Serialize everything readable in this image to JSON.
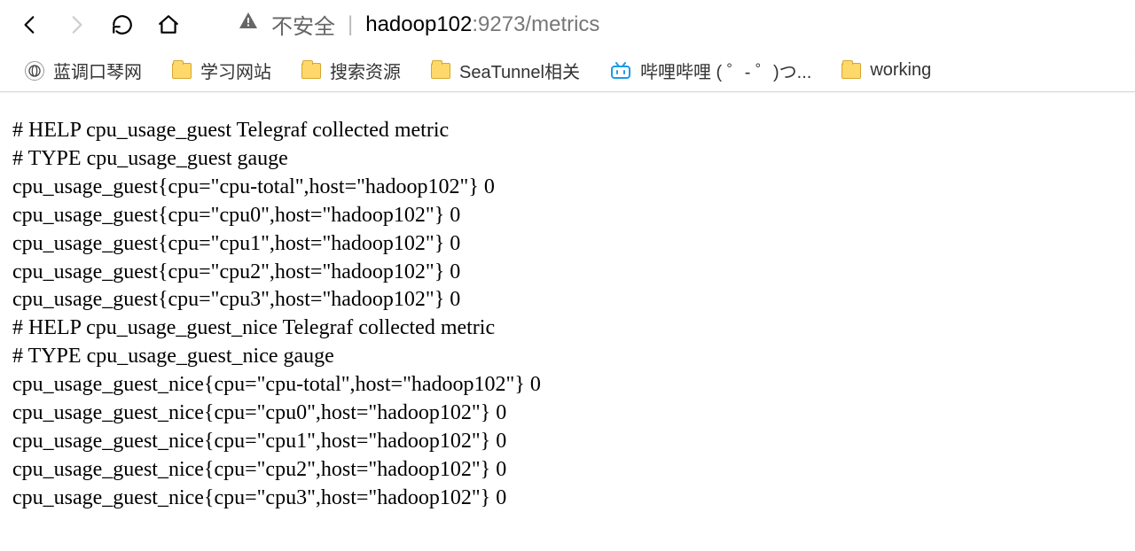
{
  "address": {
    "security_label": "不安全",
    "host": "hadoop102",
    "port_path": ":9273/metrics"
  },
  "bookmarks": [
    {
      "icon": "site",
      "label": "蓝调口琴网"
    },
    {
      "icon": "folder",
      "label": "学习网站"
    },
    {
      "icon": "folder",
      "label": "搜索资源"
    },
    {
      "icon": "folder",
      "label": "SeaTunnel相关"
    },
    {
      "icon": "bili",
      "label": "哔哩哔哩 ( ゜- ゜)つ..."
    },
    {
      "icon": "folder",
      "label": "working"
    }
  ],
  "metrics": {
    "lines": [
      "# HELP cpu_usage_guest Telegraf collected metric",
      "# TYPE cpu_usage_guest gauge",
      "cpu_usage_guest{cpu=\"cpu-total\",host=\"hadoop102\"} 0",
      "cpu_usage_guest{cpu=\"cpu0\",host=\"hadoop102\"} 0",
      "cpu_usage_guest{cpu=\"cpu1\",host=\"hadoop102\"} 0",
      "cpu_usage_guest{cpu=\"cpu2\",host=\"hadoop102\"} 0",
      "cpu_usage_guest{cpu=\"cpu3\",host=\"hadoop102\"} 0",
      "# HELP cpu_usage_guest_nice Telegraf collected metric",
      "# TYPE cpu_usage_guest_nice gauge",
      "cpu_usage_guest_nice{cpu=\"cpu-total\",host=\"hadoop102\"} 0",
      "cpu_usage_guest_nice{cpu=\"cpu0\",host=\"hadoop102\"} 0",
      "cpu_usage_guest_nice{cpu=\"cpu1\",host=\"hadoop102\"} 0",
      "cpu_usage_guest_nice{cpu=\"cpu2\",host=\"hadoop102\"} 0",
      "cpu_usage_guest_nice{cpu=\"cpu3\",host=\"hadoop102\"} 0"
    ]
  }
}
